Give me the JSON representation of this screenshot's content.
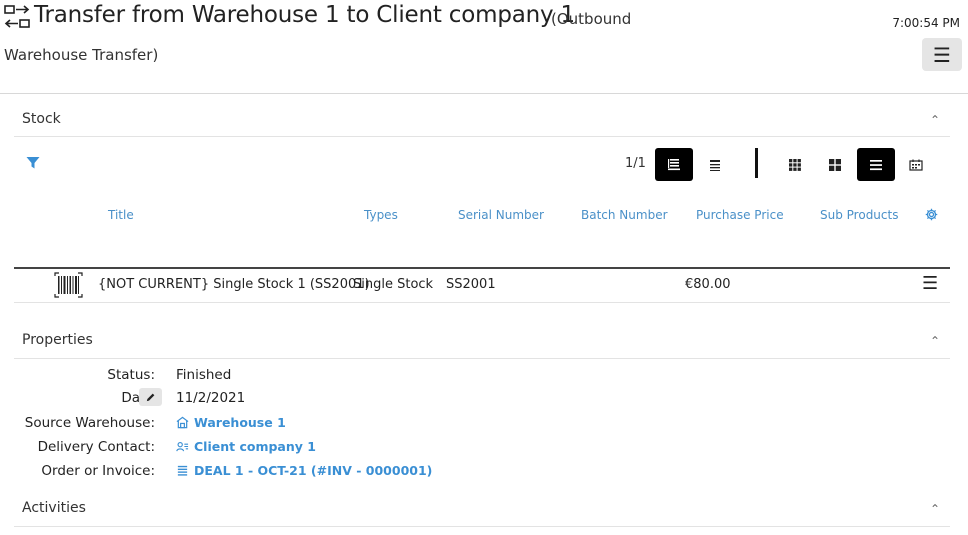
{
  "header": {
    "title": "Transfer from Warehouse 1 to Client company 1",
    "subtype_line1": "(Outbound",
    "subtype_line2": "Warehouse Transfer)",
    "clock": "7:00:54 PM",
    "menu_icon": "☰"
  },
  "stock": {
    "title": "Stock",
    "collapse_icon": "⌃",
    "pager": "1/1",
    "columns": [
      "Title",
      "Types",
      "Serial Number",
      "Batch Number",
      "Purchase Price",
      "Sub Products"
    ],
    "row": {
      "title": "{NOT CURRENT} Single Stock 1 (SS2001)",
      "type": "Single Stock",
      "serial": "SS2001",
      "batch": "",
      "price": "€80.00",
      "sub_products": "",
      "menu_icon": "☰"
    }
  },
  "properties": {
    "title": "Properties",
    "collapse_icon": "⌃",
    "status_label": "Status:",
    "status_value": "Finished",
    "date_label": "Da",
    "date_value": "11/2/2021",
    "source_label": "Source Warehouse:",
    "source_value": "Warehouse 1",
    "delivery_label": "Delivery Contact:",
    "delivery_value": "Client company 1",
    "order_label": "Order or Invoice:",
    "order_value": "DEAL 1 - OCT-21 (#INV - 0000001)"
  },
  "activities": {
    "title": "Activities",
    "collapse_icon": "⌃"
  },
  "colors": {
    "accent": "#3a8fd4",
    "column_header": "#4a90c8",
    "active_toggle": "#000000"
  },
  "icons": {
    "header": "transfer-arrows-icon",
    "filter": "filter-icon",
    "settings": "gear-icon",
    "row": "barcode-icon",
    "warehouse": "warehouse-icon",
    "contact": "contact-card-icon",
    "order": "list-icon",
    "edit": "pencil-icon"
  }
}
